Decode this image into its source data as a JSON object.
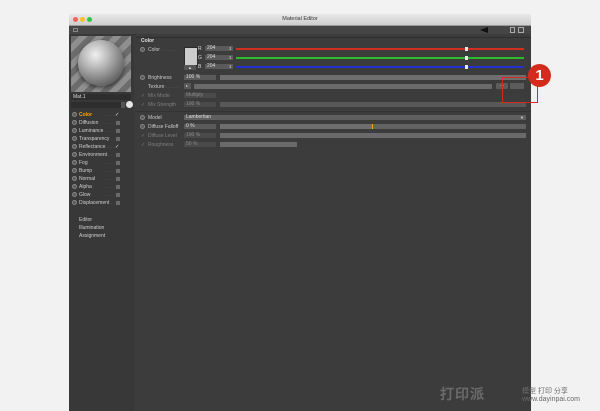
{
  "colors": {
    "accent": "#ffa500",
    "red_channel": "#d0301f",
    "green_channel": "#2dbb2d",
    "blue_channel": "#2233cc",
    "callout": "#d42a1c"
  },
  "window": {
    "title": "Material Editor",
    "traffic_lights": [
      "#fb5f57",
      "#fcbd2e",
      "#2ec842"
    ],
    "toolbar_icons": [
      "arrow-back-icon",
      "lock-icon",
      "menu-icon"
    ]
  },
  "left_panel": {
    "material_name": "Mat.1",
    "channels": [
      {
        "label": "Color",
        "checked": true,
        "active": true
      },
      {
        "label": "Diffusion",
        "checked": false,
        "active": false
      },
      {
        "label": "Luminance",
        "checked": false,
        "active": false
      },
      {
        "label": "Transparency",
        "checked": false,
        "active": false
      },
      {
        "label": "Reflectance",
        "checked": true,
        "active": false
      },
      {
        "label": "Environment",
        "checked": false,
        "active": false
      },
      {
        "label": "Fog",
        "checked": false,
        "active": false
      },
      {
        "label": "Bump",
        "checked": false,
        "active": false
      },
      {
        "label": "Normal",
        "checked": false,
        "active": false
      },
      {
        "label": "Alpha",
        "checked": false,
        "active": false
      },
      {
        "label": "Glow",
        "checked": false,
        "active": false
      },
      {
        "label": "Displacement",
        "checked": false,
        "active": false
      }
    ],
    "pages": [
      "Editor",
      "Illumination",
      "Assignment"
    ]
  },
  "main": {
    "section_title": "Color",
    "color": {
      "label": "Color",
      "swatch": "#cccccc",
      "channels": [
        {
          "name": "R",
          "value": "204",
          "level": 0.8
        },
        {
          "name": "G",
          "value": "204",
          "level": 0.8
        },
        {
          "name": "B",
          "value": "204",
          "level": 0.8
        }
      ]
    },
    "brightness": {
      "label": "Brightness",
      "value": "100 %",
      "level": 1.0
    },
    "texture": {
      "label": "Texture",
      "button": "..."
    },
    "mix_mode": {
      "label": "Mix Mode",
      "value": "Multiply"
    },
    "mix_strength": {
      "label": "Mix Strength",
      "value": "100 %",
      "level": 1.0
    },
    "model": {
      "label": "Model",
      "value": "Lambertian"
    },
    "diffuse_falloff": {
      "label": "Diffuse Falloff",
      "value": "0 %",
      "level": 0.5
    },
    "diffuse_level": {
      "label": "Diffuse Level",
      "value": "100 %",
      "level": 1.0
    },
    "roughness": {
      "label": "Roughness",
      "value": "50 %",
      "level": 0.25
    }
  },
  "callout": {
    "number": "1"
  },
  "watermark": {
    "logo": "打印派",
    "tagline": "模型 打印 分享",
    "url": "www.dayinpai.com"
  }
}
